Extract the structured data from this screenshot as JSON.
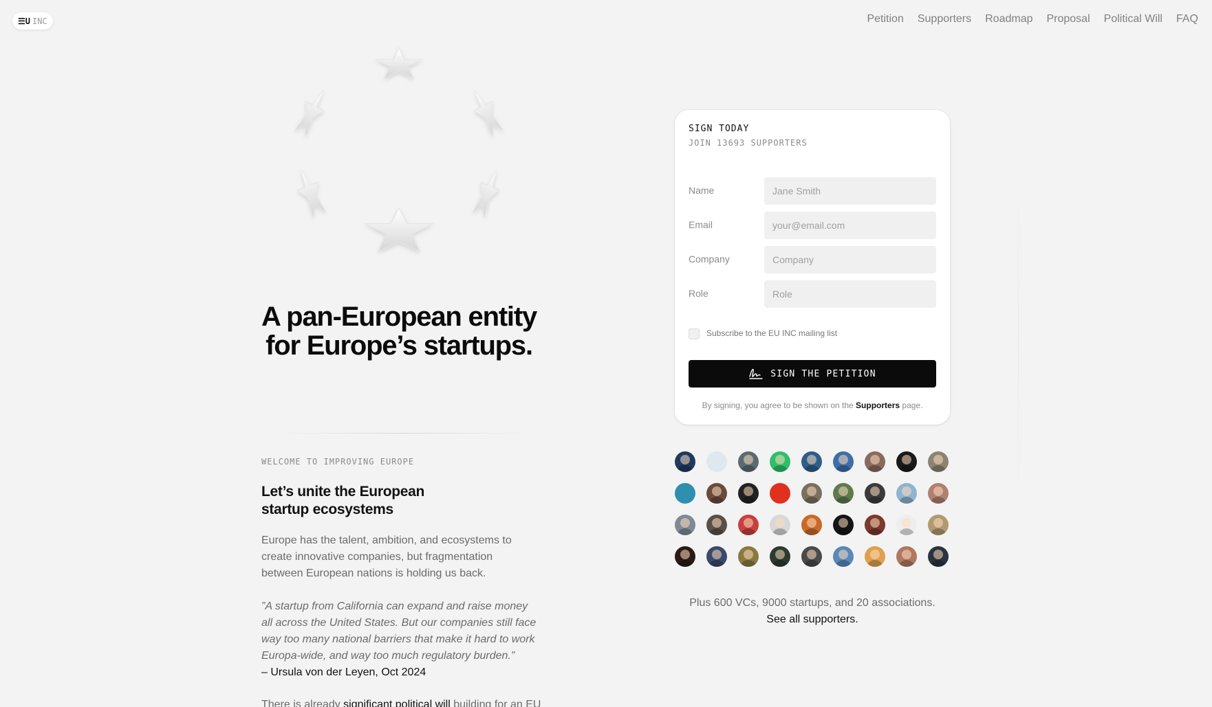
{
  "header": {
    "logo_mark": "☰U",
    "logo_sub": "INC",
    "nav": [
      "Petition",
      "Supporters",
      "Roadmap",
      "Proposal",
      "Political Will",
      "FAQ"
    ]
  },
  "hero": {
    "title": "A pan-European entity for Europe’s startups."
  },
  "intro": {
    "eyebrow": "WELCOME TO IMPROVING EUROPE",
    "title": "Let’s unite the European startup ecosystems",
    "body": "Europe has the talent, ambition, and ecosystems to create innovative companies, but fragmentation between European nations is holding us back.",
    "quote": "”A startup from California can expand and raise money all across the United States. But our companies still face way too many national barriers that make it hard to work Europa-wide, and way too much regulatory burden.”",
    "quote_author": "– Ursula von der Leyen, Oct 2024",
    "more_prefix": "There is already ",
    "more_link": "significant political will",
    "more_suffix": " building for an EU"
  },
  "petition": {
    "heading": "SIGN TODAY",
    "subheading": "JOIN 13693 SUPPORTERS",
    "fields": [
      {
        "label": "Name",
        "placeholder": "Jane Smith",
        "value": ""
      },
      {
        "label": "Email",
        "placeholder": "your@email.com",
        "value": ""
      },
      {
        "label": "Company",
        "placeholder": "Company",
        "value": ""
      },
      {
        "label": "Role",
        "placeholder": "Role",
        "value": ""
      }
    ],
    "subscribe_label": "Subscribe to the EU INC mailing list",
    "subscribe_checked": false,
    "button_label": "SIGN THE PETITION",
    "button_icon": "signature-icon",
    "footer_prefix": "By signing, you agree to be shown on the ",
    "footer_link": "Supporters",
    "footer_suffix": " page."
  },
  "supporters": {
    "text": "Plus 600 VCs, 9000 startups, and 20 associations.",
    "link": "See all supporters.",
    "avatar_colors": [
      "#1f3a5f",
      "#dfe8ee",
      "#5a6b72",
      "#2fbf6a",
      "#2c5f8a",
      "#3d6ea8",
      "#8a6a5c",
      "#1a1a1a",
      "#8c8472",
      "#2f8fb0",
      "#6b4a3c",
      "#222222",
      "#e0301e",
      "#7a7060",
      "#5e7a4e",
      "#3b3b3b",
      "#8fb4d0",
      "#b08070",
      "#7f8a96",
      "#5b5048",
      "#c84040",
      "#d8d8d8",
      "#c86a2a",
      "#151515",
      "#7a3a2c",
      "#eeeeee",
      "#b09a70",
      "#2a1a14",
      "#3a4a6a",
      "#8a7a40",
      "#2e3a30",
      "#4a4a4a",
      "#5a88b8",
      "#e0a050",
      "#b07860",
      "#2a3440"
    ]
  }
}
